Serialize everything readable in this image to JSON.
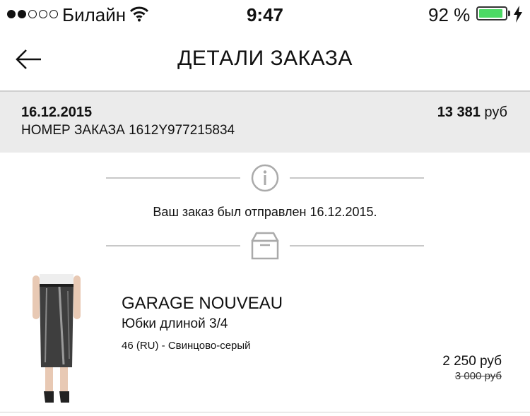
{
  "status_bar": {
    "carrier": "Билайн",
    "time": "9:47",
    "battery_percent": "92 %",
    "signal_bars_filled": 2,
    "signal_bars_total": 5,
    "battery_level": 0.92,
    "charging": true
  },
  "nav": {
    "back_icon": "arrow-left-icon",
    "title": "ДЕТАЛИ ЗАКАЗА"
  },
  "order": {
    "date": "16.12.2015",
    "number_label": "НОМЕР ЗАКАЗА",
    "number": "1612Y977215834",
    "total_amount": "13 381",
    "currency": "руб"
  },
  "status": {
    "info_icon": "info-icon",
    "message": "Ваш заказ был отправлен 16.12.2015.",
    "box_icon": "box-icon"
  },
  "items": [
    {
      "brand": "GARAGE NOUVEAU",
      "type": "Юбки длиной 3/4",
      "variant": "46 (RU) - Свинцово-серый",
      "price": "2 250 руб",
      "old_price": "3 000 руб"
    }
  ],
  "colors": {
    "summary_bg": "#ebebeb",
    "divider": "#c8c8c8",
    "battery_green": "#4cd964"
  }
}
